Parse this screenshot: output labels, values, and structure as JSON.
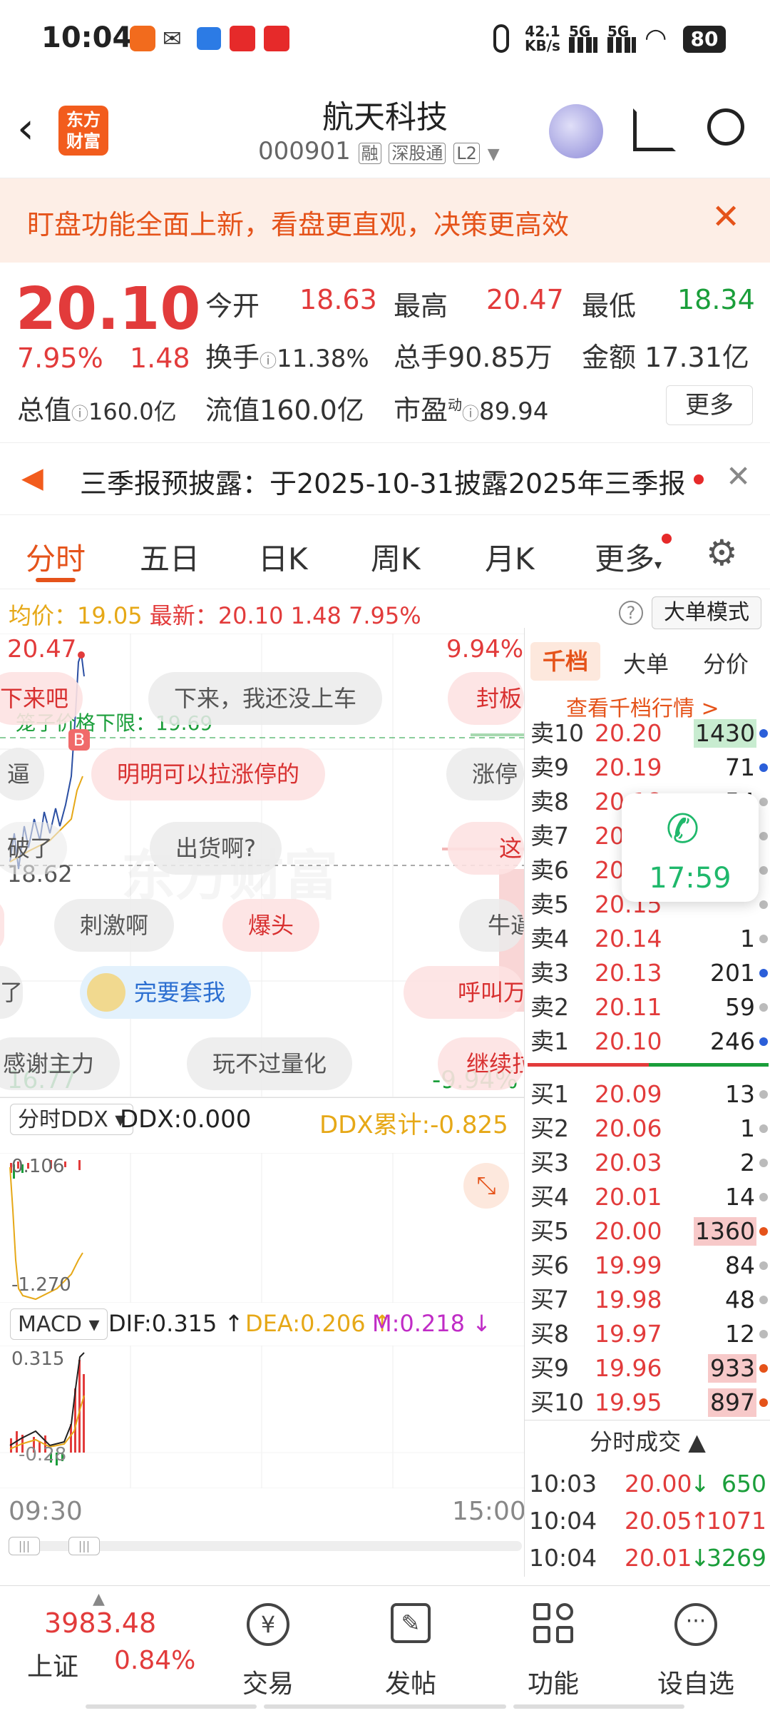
{
  "status_bar": {
    "time": "10:04",
    "net_speed": "42.1",
    "net_unit": "KB/s",
    "signal1": "5G",
    "signal2": "5G",
    "battery": "80"
  },
  "header": {
    "logo_text_top": "东方",
    "logo_text_bottom": "财富",
    "stock_name": "航天科技",
    "stock_code": "000901",
    "tags": [
      "融",
      "深股通",
      "L2"
    ]
  },
  "banner": {
    "text": "盯盘功能全面上新，看盘更直观，决策更高效"
  },
  "quote": {
    "price": "20.10",
    "change_pct": "7.95%",
    "change": "1.48",
    "open_label": "今开",
    "open": "18.63",
    "high_label": "最高",
    "high": "20.47",
    "low_label": "最低",
    "low": "18.34",
    "turnover_label": "换手",
    "turnover": "11.38%",
    "volume_label": "总手",
    "volume": "90.85万",
    "amount_label": "金额",
    "amount": "17.31亿",
    "mktcap_label": "总值",
    "mktcap": "160.0亿",
    "float_label": "流值",
    "float": "160.0亿",
    "pe_label": "市盈",
    "pe_sup": "动",
    "pe": "89.94",
    "more_btn": "更多"
  },
  "notice": {
    "text": "三季报预披露：于2025-10-31披露2025年三季报"
  },
  "tabs": [
    "分时",
    "五日",
    "日K",
    "周K",
    "月K",
    "更多"
  ],
  "chart": {
    "avg_label": "均价：",
    "avg": "19.05",
    "latest_label": "最新：",
    "latest": "20.10",
    "latest_chg": "1.48",
    "latest_pct": "7.95%",
    "mode_btn": "大单模式",
    "top_price": "20.47",
    "top_pct": "9.94%",
    "bottom_price": "16.77",
    "bottom_pct": "-9.94%",
    "ref_price": "18.62",
    "limit_text": "笼子价格下限：19.69",
    "marker_b": "B",
    "watermark": "东方财富",
    "danmu": [
      "下来吧",
      "下来，我还没上车",
      "封板",
      "逼",
      "明明可以拉涨停的",
      "涨停",
      "破了",
      "出货啊?",
      "这",
      "刺激啊",
      "爆头",
      "牛逼",
      "了",
      "完要套我",
      "呼叫万",
      "感谢主力",
      "玩不过量化",
      "继续拉"
    ],
    "ddx_selector": "分时DDX",
    "ddx_value": "DDX:0.000",
    "ddx_cum": "DDX累计:-0.825",
    "ddx_top": "0.106",
    "ddx_bottom": "-1.270",
    "macd_selector": "MACD",
    "dif": "DIF:0.315",
    "dea": "DEA:0.206",
    "m": "M:0.218",
    "macd_top": "0.315",
    "macd_bottom": "-0.28",
    "time_start": "09:30",
    "time_end": "15:00"
  },
  "depth": {
    "tabs": [
      "千档",
      "大单",
      "分价"
    ],
    "link": "查看千档行情 >",
    "sell": [
      {
        "label": "卖10",
        "price": "20.20",
        "vol": "1430"
      },
      {
        "label": "卖9",
        "price": "20.19",
        "vol": "71"
      },
      {
        "label": "卖8",
        "price": "20.18",
        "vol": "54"
      },
      {
        "label": "卖7",
        "price": "20.17",
        "vol": ""
      },
      {
        "label": "卖6",
        "price": "20.16",
        "vol": ""
      },
      {
        "label": "卖5",
        "price": "20.15",
        "vol": ""
      },
      {
        "label": "卖4",
        "price": "20.14",
        "vol": "1"
      },
      {
        "label": "卖3",
        "price": "20.13",
        "vol": "201"
      },
      {
        "label": "卖2",
        "price": "20.11",
        "vol": "59"
      },
      {
        "label": "卖1",
        "price": "20.10",
        "vol": "246"
      }
    ],
    "buy": [
      {
        "label": "买1",
        "price": "20.09",
        "vol": "13"
      },
      {
        "label": "买2",
        "price": "20.06",
        "vol": "1"
      },
      {
        "label": "买3",
        "price": "20.03",
        "vol": "2"
      },
      {
        "label": "买4",
        "price": "20.01",
        "vol": "14"
      },
      {
        "label": "买5",
        "price": "20.00",
        "vol": "1360"
      },
      {
        "label": "买6",
        "price": "19.99",
        "vol": "84"
      },
      {
        "label": "买7",
        "price": "19.98",
        "vol": "48"
      },
      {
        "label": "买8",
        "price": "19.97",
        "vol": "12"
      },
      {
        "label": "买9",
        "price": "19.96",
        "vol": "933"
      },
      {
        "label": "买10",
        "price": "19.95",
        "vol": "897"
      }
    ],
    "trades_title": "分时成交",
    "trades": [
      {
        "time": "10:03",
        "price": "20.00",
        "dir": "↓",
        "vol": "650"
      },
      {
        "time": "10:04",
        "price": "20.05",
        "dir": "↑",
        "vol": "1071"
      },
      {
        "time": "10:04",
        "price": "20.01",
        "dir": "↓",
        "vol": "3269"
      }
    ]
  },
  "call_widget": {
    "time": "17:59"
  },
  "bottom_nav": {
    "index_value": "3983.48",
    "index_name": "上证",
    "index_pct": "0.84%",
    "items": [
      "交易",
      "发帖",
      "功能",
      "设自选"
    ]
  }
}
